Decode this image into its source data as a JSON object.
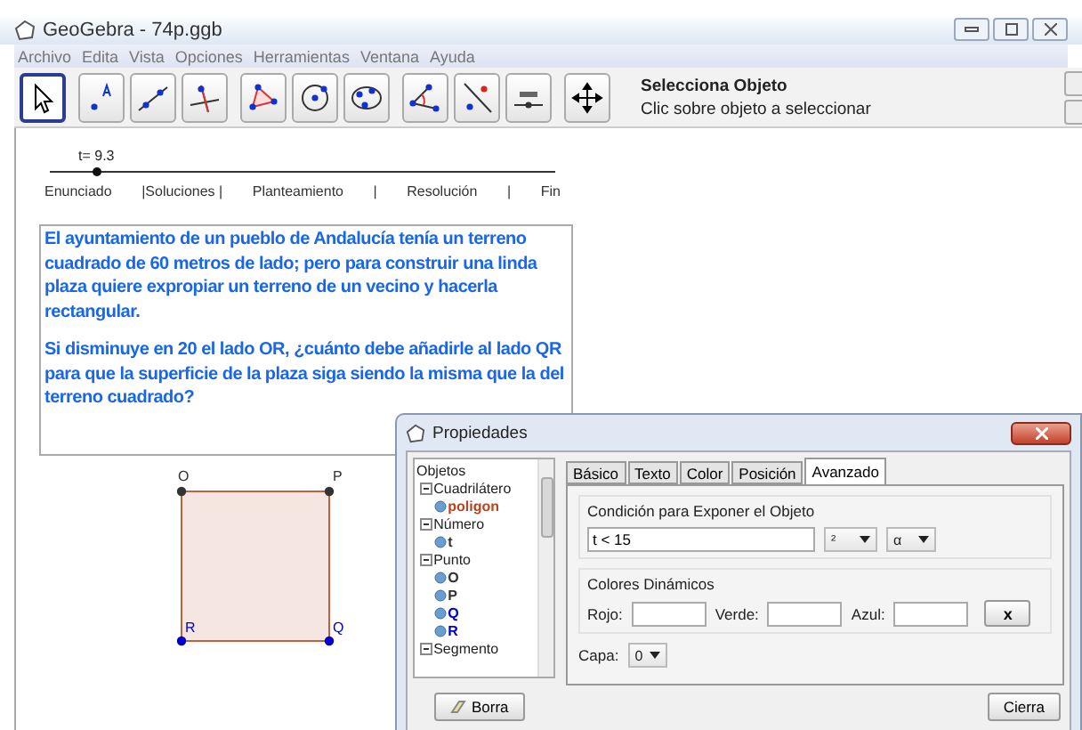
{
  "window": {
    "title": "GeoGebra - 74p.ggb"
  },
  "menu": [
    "Archivo",
    "Edita",
    "Vista",
    "Opciones",
    "Herramientas",
    "Ventana",
    "Ayuda"
  ],
  "tools": [
    {
      "kind": "move",
      "selected": true
    },
    {
      "kind": "point",
      "selected": false
    },
    {
      "kind": "line",
      "selected": false
    },
    {
      "kind": "perpendicular",
      "selected": false
    },
    {
      "kind": "polygon",
      "selected": false
    },
    {
      "kind": "circle",
      "selected": false
    },
    {
      "kind": "conic",
      "selected": false
    },
    {
      "kind": "angle",
      "selected": false
    },
    {
      "kind": "reflect",
      "selected": false
    },
    {
      "kind": "slider",
      "selected": false
    },
    {
      "kind": "pan",
      "selected": false
    }
  ],
  "tool_help": {
    "title": "Selecciona Objeto",
    "text": "Clic sobre objeto a seleccionar"
  },
  "slider": {
    "label": "t= 9.3",
    "level": 0.09
  },
  "nav": [
    "Enunciado",
    "|Soluciones |",
    "Planteamiento",
    "|",
    "Resolución",
    "|",
    "Fin"
  ],
  "problem": [
    "El ayuntamiento de un pueblo de Andalucía tenía un terreno cuadrado de 60 metros de lado; pero para construir una linda plaza quiere expropiar un terreno de un vecino y hacerla rectangular.",
    "Si disminuye en 20 el lado OR, ¿cuánto debe añadirle al lado QR para que la superficie de la plaza siga siendo la misma que la del terreno cuadrado?"
  ],
  "points": [
    {
      "label": "O",
      "color": "#333333"
    },
    {
      "label": "P",
      "color": "#333333"
    },
    {
      "label": "R",
      "color": "#0000cc"
    },
    {
      "label": "Q",
      "color": "#0000cc"
    }
  ],
  "dialog": {
    "title": "Propiedades",
    "tree": {
      "label": "Objetos",
      "children": [
        {
          "label": "Cuadrilátero",
          "expanded": true,
          "children": [
            {
              "label": "poligon",
              "color": "#b5441f"
            }
          ]
        },
        {
          "label": "Número",
          "expanded": true,
          "children": [
            {
              "label": "t",
              "color": "#333333"
            }
          ]
        },
        {
          "label": "Punto",
          "expanded": true,
          "children": [
            {
              "label": "O",
              "color": "#333333"
            },
            {
              "label": "P",
              "color": "#333333"
            },
            {
              "label": "Q",
              "color": "#0000cc"
            },
            {
              "label": "R",
              "color": "#0000cc"
            }
          ]
        },
        {
          "label": "Segmento",
          "expanded": true
        }
      ]
    },
    "tabs": [
      {
        "label": "Básico",
        "selected": false
      },
      {
        "label": "Texto",
        "selected": false
      },
      {
        "label": "Color",
        "selected": false
      },
      {
        "label": "Posición",
        "selected": false
      },
      {
        "label": "Avanzado",
        "selected": true
      }
    ],
    "condition": {
      "title": "Condición para Exponer el Objeto",
      "value": "t < 15",
      "menu_1": "²",
      "menu_2": "α"
    },
    "dynamic_colors": {
      "title": "Colores Dinámicos",
      "fields": [
        "Rojo:",
        "Verde:",
        "Azul:"
      ],
      "clear": "x"
    },
    "layer": {
      "label": "Capa:",
      "value": "0"
    },
    "buttons": {
      "delete": "Borra",
      "close": "Cierra"
    }
  }
}
